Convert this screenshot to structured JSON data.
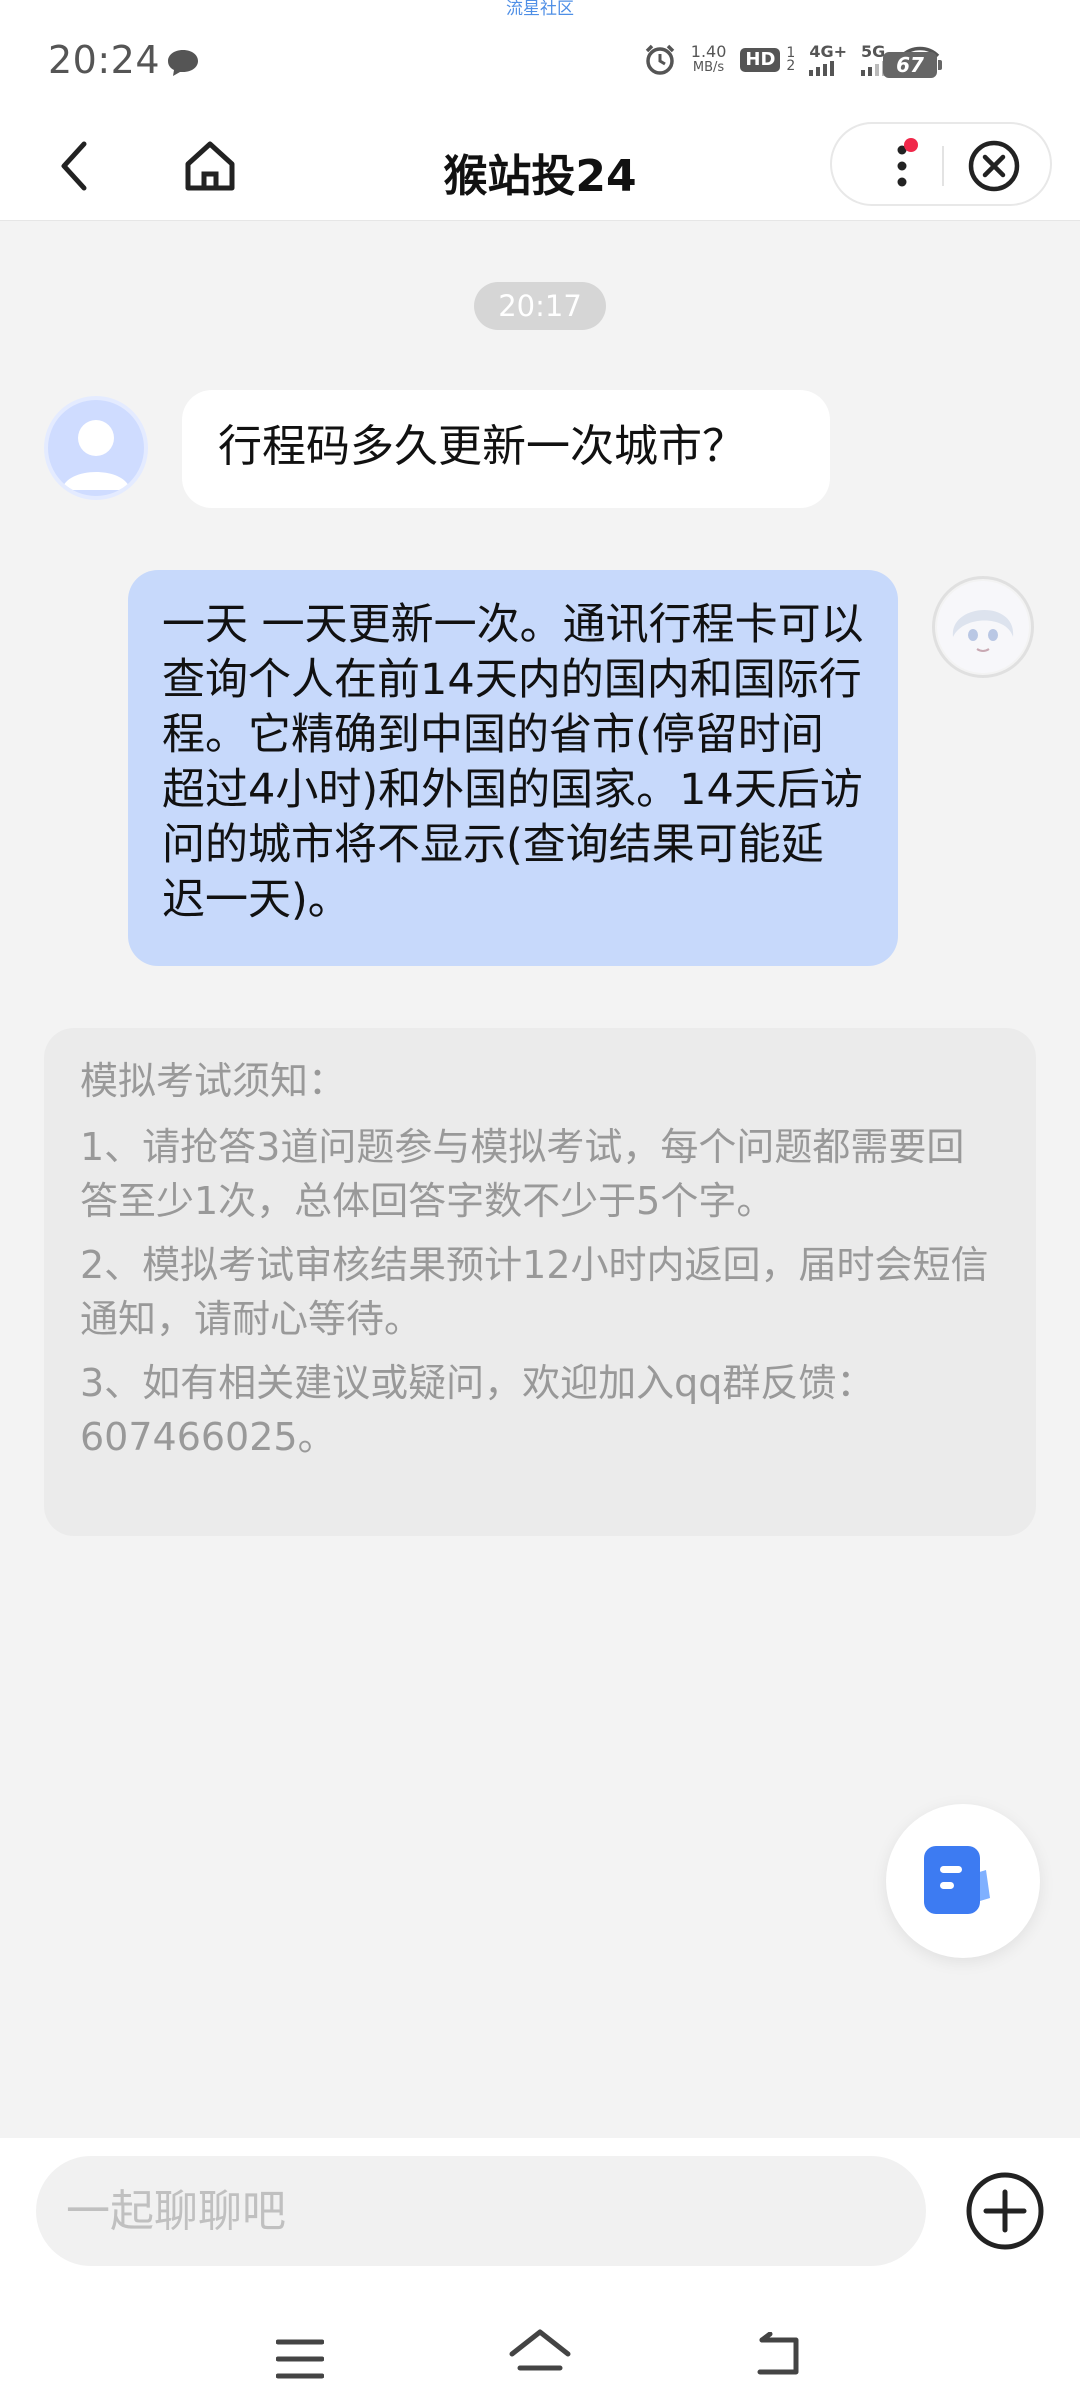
{
  "top_tag": "流星社区",
  "status_bar": {
    "time": "20:24",
    "net_speed_value": "1.40",
    "net_speed_unit": "MB/s",
    "hd_label": "HD",
    "hd_sub_top": "1",
    "hd_sub_bottom": "2",
    "net_4g_label": "4G+",
    "net_5g_label": "5G",
    "battery": "67"
  },
  "nav": {
    "title": "猴站投24"
  },
  "chat": {
    "timestamp": "20:17",
    "question": "行程码多久更新一次城市？",
    "answer": "一天 一天更新一次。通讯行程卡可以查询个人在前14天内的国内和国际行程。它精确到中国的省市(停留时间超过4小时)和外国的国家。14天后访问的城市将不显示(查询结果可能延迟一天)。"
  },
  "notice": {
    "title": "模拟考试须知：",
    "items": [
      "1、请抢答3道问题参与模拟考试，每个问题都需要回答至少1次，总体回答字数不少于5个字。",
      "2、模拟考试审核结果预计12小时内返回，届时会短信通知，请耐心等待。",
      "3、如有相关建议或疑问，欢迎加入qq群反馈：607466025。"
    ]
  },
  "input": {
    "placeholder": "一起聊聊吧"
  },
  "colors": {
    "accent_blue": "#3d7bf2",
    "answer_bubble": "#c7d9fb",
    "notification_dot": "#f0284a"
  }
}
